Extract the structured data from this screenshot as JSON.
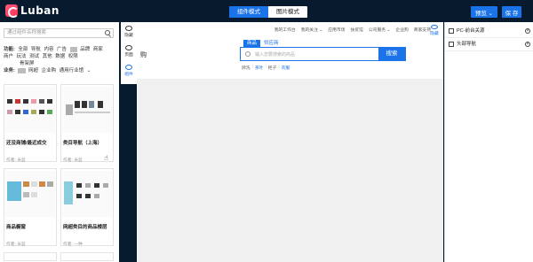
{
  "app": {
    "logo_text": "Luban"
  },
  "toolbar": {
    "mode_component": "组件模式",
    "mode_image": "图片模式",
    "preview_label": "预览 ⌄",
    "save_label": "保 存"
  },
  "left": {
    "search_placeholder": "通过组件名称搜索",
    "filter_label_func": "功能:",
    "func_items": [
      "全部",
      "导航",
      "内容",
      "广告",
      "",
      "品牌",
      "商家",
      "商户",
      "玩法",
      "测试",
      "其他",
      "数据",
      "权限",
      "骨架屏"
    ],
    "filter_label_biz": "业务:",
    "biz_items": [
      "",
      "网超",
      "企业购",
      "通用行业馆"
    ],
    "cards": [
      {
        "title": "还没商铺/最近成交",
        "author": "作者: 米蓝"
      },
      {
        "title": "类目导航（上海）",
        "author": "作者: 米蓝"
      },
      {
        "title": "商品橱窗",
        "author": "作者: 米蓝"
      },
      {
        "title": "网超类目的商品楼层",
        "author": "作者: 一种"
      }
    ]
  },
  "side_tools": {
    "hide_label": "隐藏",
    "page_label": "页面",
    "component_label": "组件"
  },
  "canvas": {
    "topnav": [
      "我的工作台",
      "我的关注 ⌄",
      "",
      "应用市场",
      "扶贫馆",
      "公司服务 ⌄",
      "企业购",
      "商家支持"
    ],
    "eye_label": "隐藏",
    "partial_char": "购",
    "tab_goods": "商品",
    "tab_supplier": "供应商",
    "search_placeholder": "输入您要搜索的商品",
    "search_button": "搜索",
    "hotwords": [
      "牌洗",
      "茶叶",
      "柜子",
      "衣服"
    ]
  },
  "right": {
    "layers": [
      "PC-前台关源",
      "头部导航"
    ]
  },
  "colors": {
    "accent": "#1a73e8",
    "topbar": "#071a2e"
  }
}
